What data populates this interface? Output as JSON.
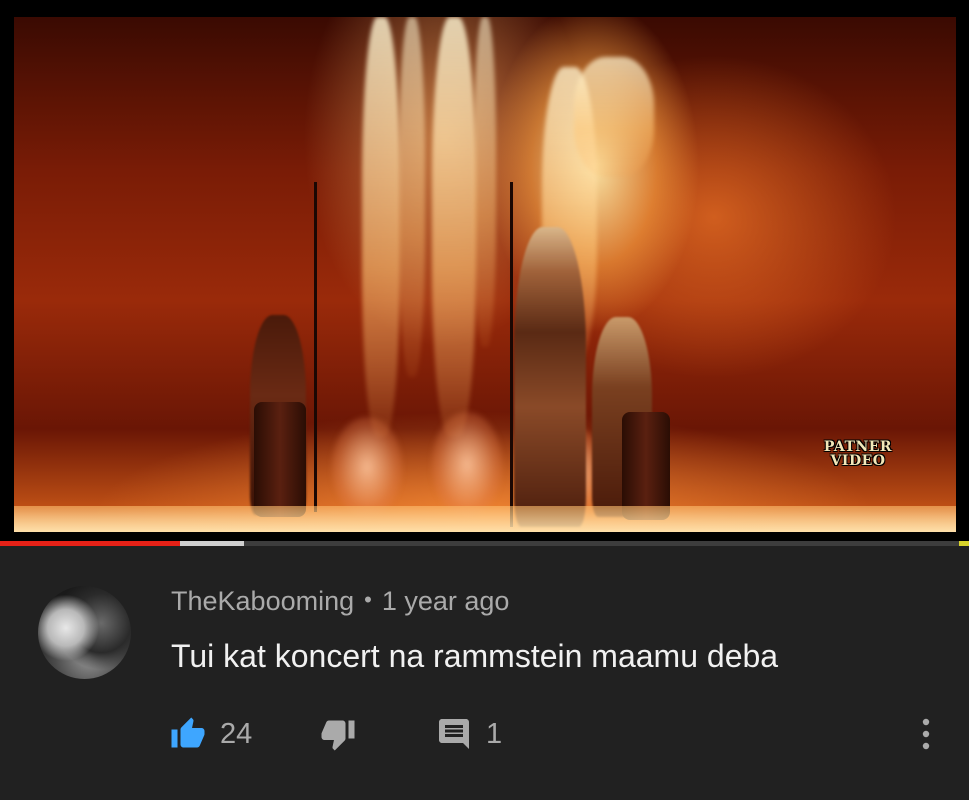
{
  "video": {
    "watermark_line1": "PATNER",
    "watermark_line2": "VIDEO",
    "progress_played": 0.186,
    "progress_buffered": 0.252
  },
  "comment": {
    "author": "TheKabooming",
    "separator": "•",
    "timestamp": "1 year ago",
    "text": "Tui kat koncert na rammstein maamu deba",
    "avatar_icon": "avatar-photo",
    "actions": {
      "like_icon": "thumbs-up-icon",
      "like_count": "24",
      "like_color": "#3ea6ff",
      "dislike_icon": "thumbs-down-icon",
      "reply_icon": "comment-reply-icon",
      "reply_count": "1",
      "more_icon": "more-vert-icon"
    }
  },
  "colors": {
    "background": "#212121",
    "progress_played": "#e62117",
    "author_text": "#aaaaaa",
    "comment_text": "#f1f1f1"
  }
}
